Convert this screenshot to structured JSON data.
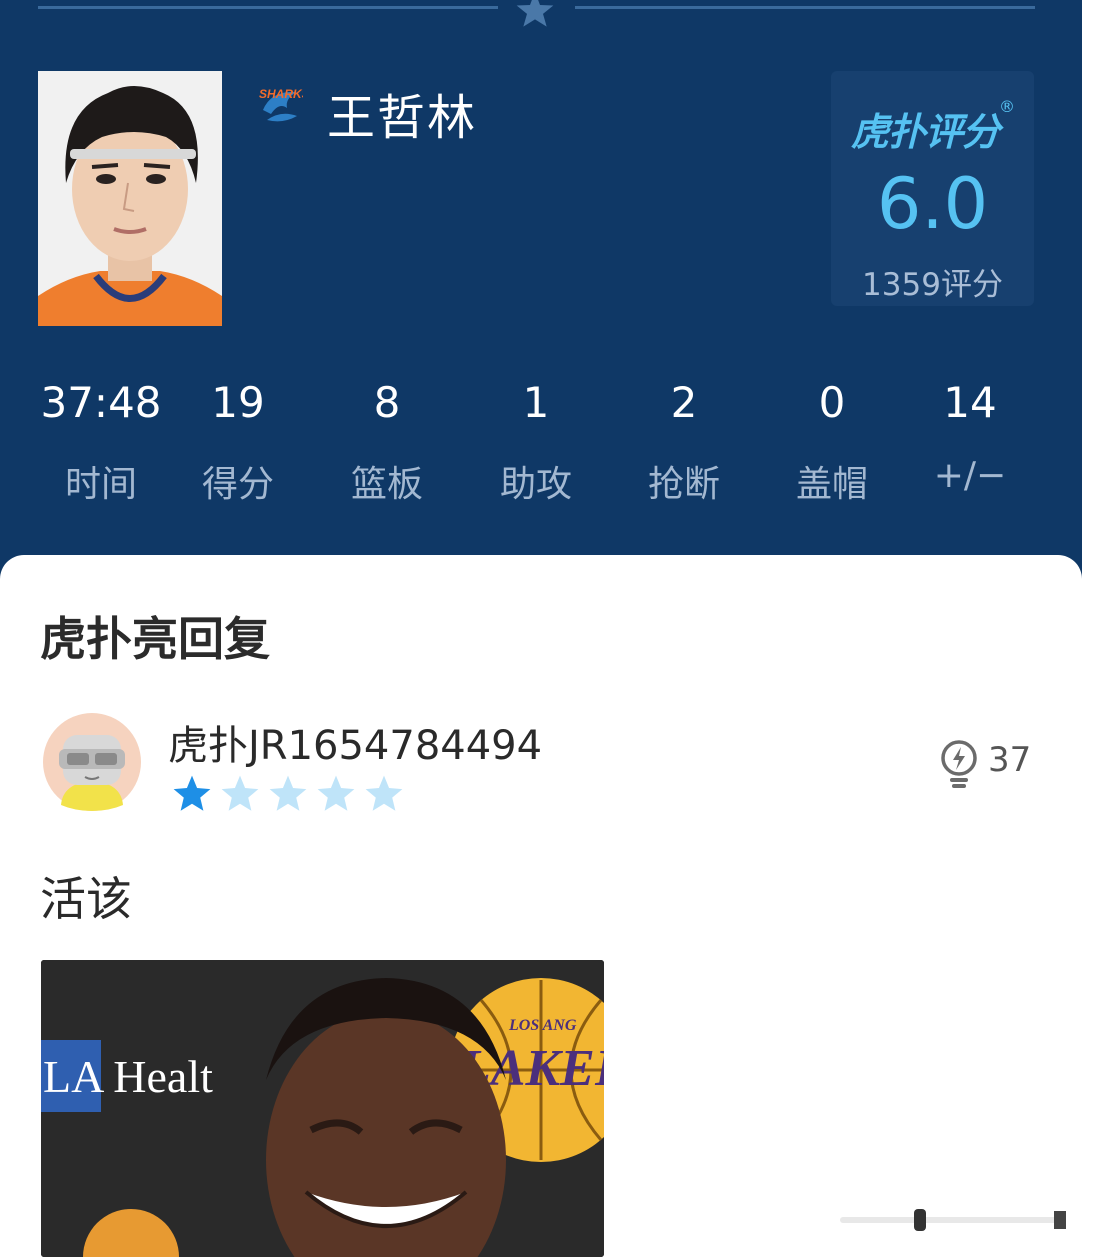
{
  "player": {
    "name": "王哲林",
    "team_logo_text": "SHARKS"
  },
  "rating": {
    "brand": "虎扑评分",
    "trademark": "®",
    "score": "6.0",
    "count_label": "1359评分"
  },
  "stats": [
    {
      "value": "37:48",
      "label": "时间"
    },
    {
      "value": "19",
      "label": "得分"
    },
    {
      "value": "8",
      "label": "篮板"
    },
    {
      "value": "1",
      "label": "助攻"
    },
    {
      "value": "2",
      "label": "抢断"
    },
    {
      "value": "0",
      "label": "盖帽"
    },
    {
      "value": "14",
      "label": "+/−"
    }
  ],
  "reply_section": {
    "title": "虎扑亮回复",
    "comment": {
      "username": "虎扑JR1654784494",
      "rating": 1,
      "rating_max": 5,
      "light_count": "37",
      "text": "活该",
      "image_text": {
        "sponsor": "LA Healt",
        "team": "LAKERS",
        "team_city": "LOS ANG"
      }
    }
  },
  "colors": {
    "header_bg": "#0f3866",
    "accent_blue": "#56c2f2",
    "star_active": "#1e8fe6",
    "star_inactive": "#bfe4f9"
  }
}
